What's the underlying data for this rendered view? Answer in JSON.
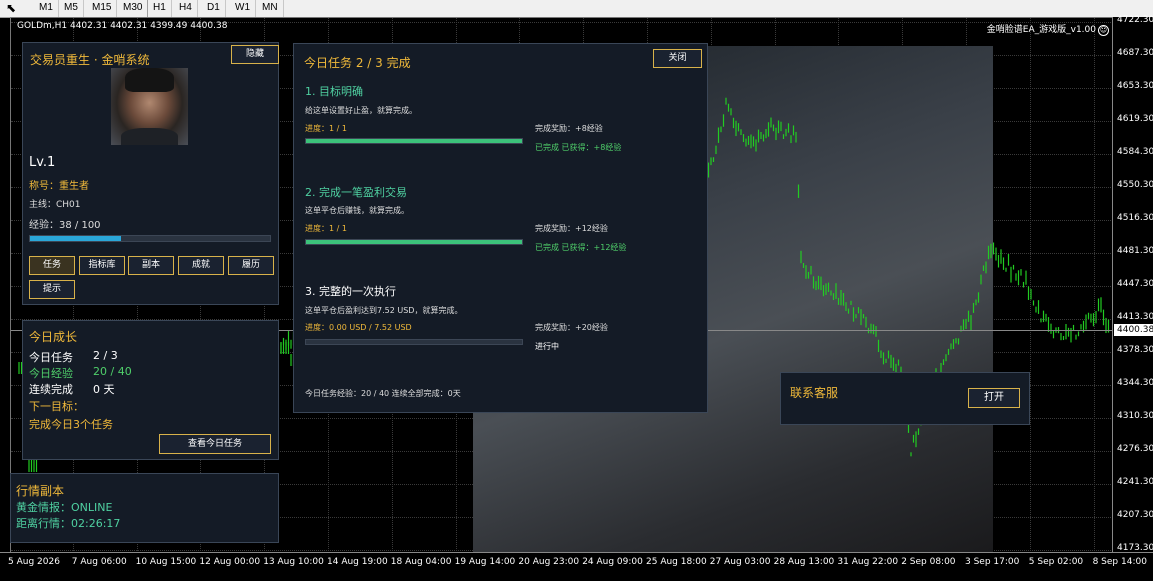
{
  "toolbar": {
    "timeframes": [
      "M1",
      "M5",
      "M15",
      "M30",
      "H1",
      "H4",
      "D1",
      "W1",
      "MN"
    ]
  },
  "chart": {
    "title": "GOLDm,H1  4402.31 4402.31 4399.49 4400.38",
    "ea_label": "金哨脸谱EA_游戏版_v1.00",
    "current_price": "4400.38",
    "y_ticks": [
      "4722.30",
      "4687.30",
      "4653.30",
      "4619.30",
      "4584.30",
      "4550.30",
      "4516.30",
      "4481.30",
      "4447.30",
      "4413.30",
      "4378.30",
      "4344.30",
      "4310.30",
      "4276.30",
      "4241.30",
      "4207.30",
      "4173.30"
    ],
    "x_ticks": [
      "5 Aug 2026",
      "7 Aug 06:00",
      "10 Aug 15:00",
      "12 Aug 00:00",
      "13 Aug 10:00",
      "14 Aug 19:00",
      "18 Aug 04:00",
      "19 Aug 14:00",
      "20 Aug 23:00",
      "24 Aug 09:00",
      "25 Aug 18:00",
      "27 Aug 03:00",
      "28 Aug 13:00",
      "31 Aug 22:00",
      "2 Sep 08:00",
      "3 Sep 17:00",
      "5 Sep 02:00",
      "8 Sep 14:00"
    ],
    "colors": {
      "candle": "#22cc22",
      "background": "#000000",
      "panel": "#141b26",
      "accent": "#f0b93a",
      "progress_green": "#3cc27a",
      "progress_blue": "#2aa7d9"
    }
  },
  "profile": {
    "title": "交易员重生 · 金哨系统",
    "hide_button": "隐藏",
    "level": "Lv.1",
    "rank_label": "称号：重生者",
    "mainline_label": "主线：CH01",
    "xp_label": "经验：38 / 100",
    "xp_progress": 0.38,
    "buttons": [
      "任务",
      "指标库",
      "副本",
      "成就",
      "履历"
    ],
    "prompt_button": "提示"
  },
  "growth": {
    "title": "今日成长",
    "rows": [
      {
        "label": "今日任务",
        "value": "2 / 3"
      },
      {
        "label": "今日经验",
        "value": "20 / 40"
      },
      {
        "label": "连续完成",
        "value": "0 天"
      }
    ],
    "next_label": "下一目标：",
    "next_value": "完成今日3个任务",
    "view_button": "查看今日任务"
  },
  "market": {
    "title": "行情副本",
    "gold_label": "黄金情报：ONLINE",
    "distance_label": "距离行情：02:26:17"
  },
  "tasks": {
    "title": "今日任务  2 / 3 完成",
    "close_button": "关闭",
    "items": [
      {
        "name": "1. 目标明确",
        "desc": "给这单设置好止盈，就算完成。",
        "progress": "进度：1 / 1",
        "progress_value": 1.0,
        "reward": "完成奖励：+8经验",
        "status": "已完成  已获得：+8经验"
      },
      {
        "name": "2. 完成一笔盈利交易",
        "desc": "这单平仓后赚钱，就算完成。",
        "progress": "进度：1 / 1",
        "progress_value": 1.0,
        "reward": "完成奖励：+12经验",
        "status": "已完成  已获得：+12经验"
      },
      {
        "name": "3. 完整的一次执行",
        "desc": "这单平仓后盈利达到7.52 USD，就算完成。",
        "progress": "进度：0.00 USD / 7.52 USD",
        "progress_value": 0.0,
        "reward": "完成奖励：+20经验",
        "status": "进行中"
      }
    ],
    "footer": "今日任务经验：20 / 40    连续全部完成：0天"
  },
  "service": {
    "title": "联系客服",
    "open_button": "打开"
  }
}
